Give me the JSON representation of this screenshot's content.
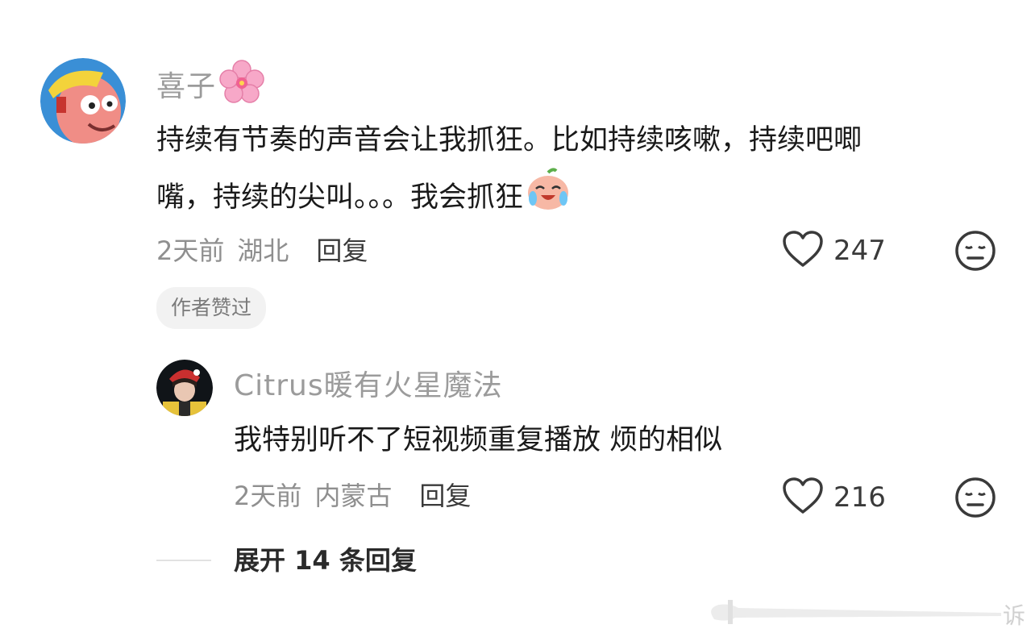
{
  "comment": {
    "username": "喜子",
    "content_line1": "持续有节奏的声音会让我抓狂。比如持续咳嗽，持续吧唧",
    "content_line2": "嘴，持续的尖叫。。。我会抓狂",
    "time": "2天前",
    "location": "湖北",
    "reply_label": "回复",
    "likes": "247",
    "badge": "作者赞过"
  },
  "reply": {
    "username": "Citrus暖有火星魔法",
    "content": "我特别听不了短视频重复播放 烦的相似",
    "time": "2天前",
    "location": "内蒙古",
    "reply_label": "回复",
    "likes": "216"
  },
  "expand_label": "展开 14 条回复",
  "watermark_text": "诉",
  "icons": {
    "name_decoration": "cherry-blossom-icon",
    "inline_emoji": "crying-laughing-peach-icon",
    "like": "heart-outline-icon",
    "dislike": "neutral-face-icon"
  },
  "colors": {
    "username": "#9b9b9b",
    "text": "#1a1a1a",
    "meta": "#8f8f8f",
    "badge_bg": "#f2f2f2"
  }
}
